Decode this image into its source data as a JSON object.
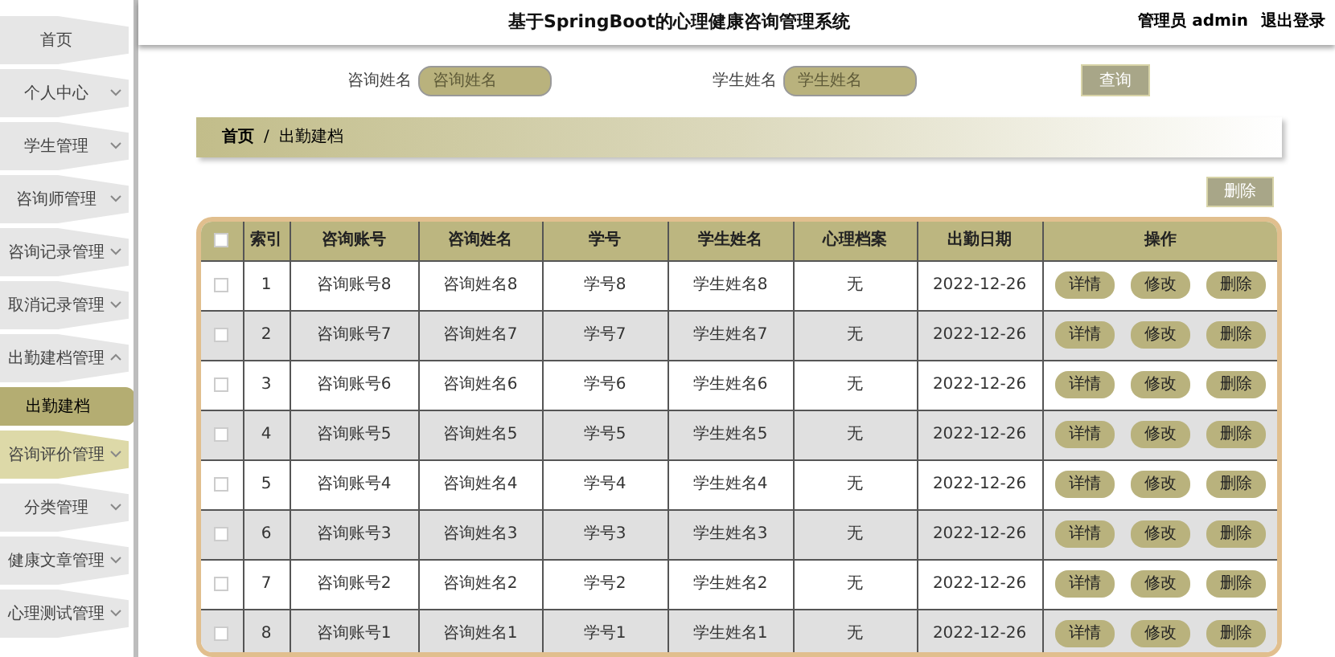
{
  "header": {
    "title": "基于SpringBoot的心理健康咨询管理系统",
    "user": "管理员 admin",
    "logout": "退出登录"
  },
  "sidebar": {
    "items": [
      {
        "label": "首页",
        "kind": "link",
        "highlighted": false
      },
      {
        "label": "个人中心",
        "kind": "menu",
        "expanded": false,
        "highlighted": false
      },
      {
        "label": "学生管理",
        "kind": "menu",
        "expanded": false,
        "highlighted": false
      },
      {
        "label": "咨询师管理",
        "kind": "menu",
        "expanded": false,
        "highlighted": false
      },
      {
        "label": "咨询记录管理",
        "kind": "menu",
        "expanded": false,
        "highlighted": false
      },
      {
        "label": "取消记录管理",
        "kind": "menu",
        "expanded": false,
        "highlighted": false
      },
      {
        "label": "出勤建档管理",
        "kind": "menu",
        "expanded": true,
        "highlighted": false,
        "children": [
          {
            "label": "出勤建档",
            "selected": true
          }
        ]
      },
      {
        "label": "咨询评价管理",
        "kind": "menu",
        "expanded": false,
        "highlighted": true
      },
      {
        "label": "分类管理",
        "kind": "menu",
        "expanded": false,
        "highlighted": false
      },
      {
        "label": "健康文章管理",
        "kind": "menu",
        "expanded": false,
        "highlighted": false
      },
      {
        "label": "心理测试管理",
        "kind": "menu",
        "expanded": false,
        "highlighted": false
      }
    ]
  },
  "search": {
    "fields": [
      {
        "label": "咨询姓名",
        "placeholder": "咨询姓名"
      },
      {
        "label": "学生姓名",
        "placeholder": "学生姓名"
      }
    ],
    "button": "查询"
  },
  "breadcrumb": [
    "首页",
    "/",
    "出勤建档"
  ],
  "delete_button": "删除",
  "table": {
    "select_all_checked": false,
    "columns": [
      "索引",
      "咨询账号",
      "咨询姓名",
      "学号",
      "学生姓名",
      "心理档案",
      "出勤日期",
      "操作"
    ],
    "rows": [
      {
        "cells": [
          "1",
          "咨询账号8",
          "咨询姓名8",
          "学号8",
          "学生姓名8",
          "无",
          "2022-12-26"
        ],
        "checked": false,
        "actions": [
          "详情",
          "修改",
          "删除"
        ]
      },
      {
        "cells": [
          "2",
          "咨询账号7",
          "咨询姓名7",
          "学号7",
          "学生姓名7",
          "无",
          "2022-12-26"
        ],
        "checked": false,
        "actions": [
          "详情",
          "修改",
          "删除"
        ]
      },
      {
        "cells": [
          "3",
          "咨询账号6",
          "咨询姓名6",
          "学号6",
          "学生姓名6",
          "无",
          "2022-12-26"
        ],
        "checked": false,
        "actions": [
          "详情",
          "修改",
          "删除"
        ]
      },
      {
        "cells": [
          "4",
          "咨询账号5",
          "咨询姓名5",
          "学号5",
          "学生姓名5",
          "无",
          "2022-12-26"
        ],
        "checked": false,
        "actions": [
          "详情",
          "修改",
          "删除"
        ]
      },
      {
        "cells": [
          "5",
          "咨询账号4",
          "咨询姓名4",
          "学号4",
          "学生姓名4",
          "无",
          "2022-12-26"
        ],
        "checked": false,
        "actions": [
          "详情",
          "修改",
          "删除"
        ]
      },
      {
        "cells": [
          "6",
          "咨询账号3",
          "咨询姓名3",
          "学号3",
          "学生姓名3",
          "无",
          "2022-12-26"
        ],
        "checked": false,
        "actions": [
          "详情",
          "修改",
          "删除"
        ]
      },
      {
        "cells": [
          "7",
          "咨询账号2",
          "咨询姓名2",
          "学号2",
          "学生姓名2",
          "无",
          "2022-12-26"
        ],
        "checked": false,
        "actions": [
          "详情",
          "修改",
          "删除"
        ]
      },
      {
        "cells": [
          "8",
          "咨询账号1",
          "咨询姓名1",
          "学号1",
          "学生姓名1",
          "无",
          "2022-12-26"
        ],
        "checked": false,
        "actions": [
          "详情",
          "修改",
          "删除"
        ]
      }
    ]
  }
}
